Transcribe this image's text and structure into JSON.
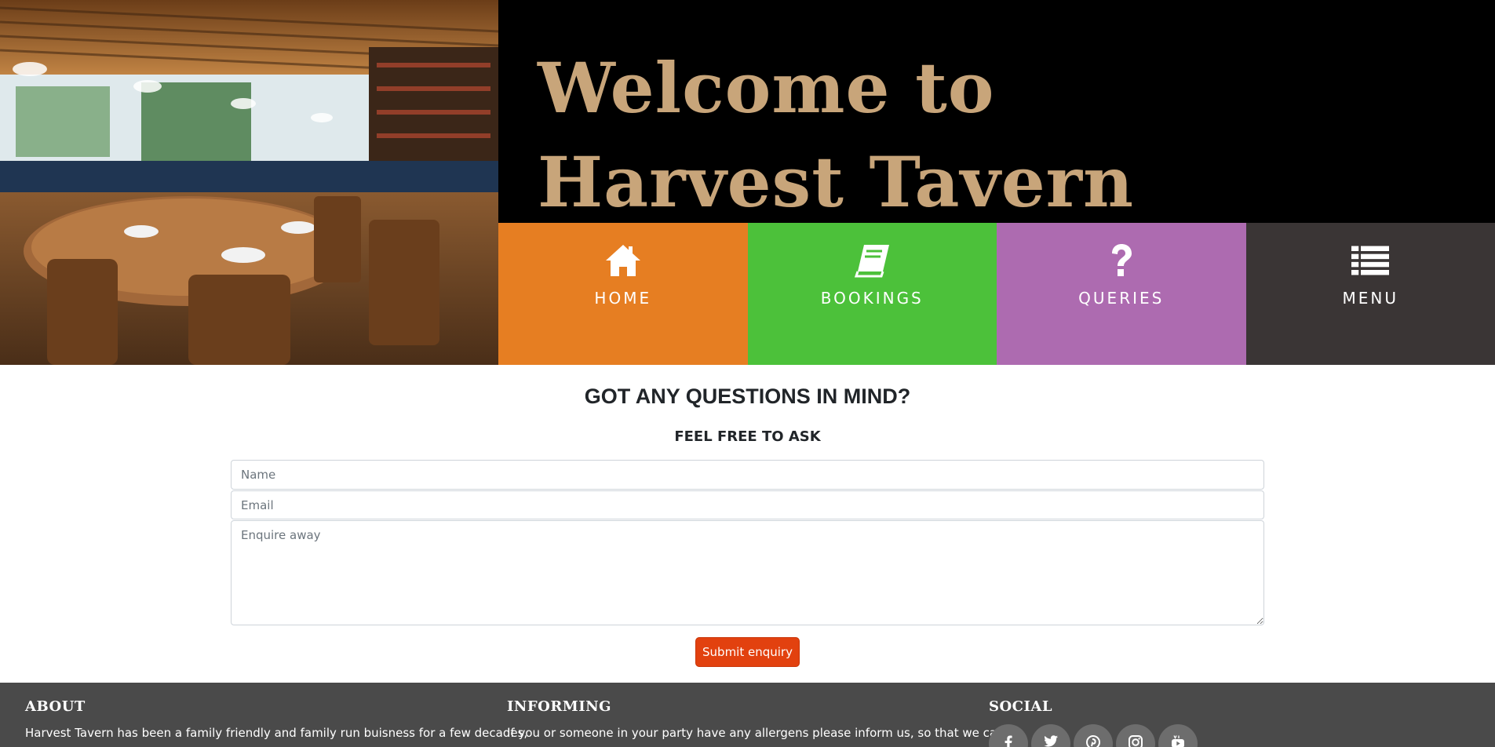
{
  "header": {
    "title": "Welcome to Harvest Tavern",
    "hero_image": "restaurant-interior-photo"
  },
  "nav": [
    {
      "label": "HOME",
      "icon": "home-icon",
      "color": "#e67e22"
    },
    {
      "label": "BOOKINGS",
      "icon": "book-icon",
      "color": "#4cc13a"
    },
    {
      "label": "QUERIES",
      "icon": "question-icon",
      "color": "#ad6bb0"
    },
    {
      "label": "MENU",
      "icon": "list-icon",
      "color": "#3a3535"
    }
  ],
  "form": {
    "heading": "GOT ANY QUESTIONS IN MIND?",
    "subheading": "FEEL FREE TO ASK",
    "name_placeholder": "Name",
    "email_placeholder": "Email",
    "message_placeholder": "Enquire away",
    "submit_label": "Submit enquiry"
  },
  "footer": {
    "about": {
      "title": "ABOUT",
      "text": "Harvest Tavern has been a family friendly and family run buisness for a few decades,"
    },
    "informing": {
      "title": "INFORMING",
      "text": "If you or someone in your party have any allergens please inform us, so that we can"
    },
    "social": {
      "title": "SOCIAL",
      "icons": [
        "facebook-icon",
        "twitter-icon",
        "pinterest-icon",
        "instagram-icon",
        "youtube-icon"
      ]
    }
  },
  "colors": {
    "title_text": "#c8a57a",
    "submit_button": "#e2410f",
    "footer_bg": "#4a4a4a"
  }
}
